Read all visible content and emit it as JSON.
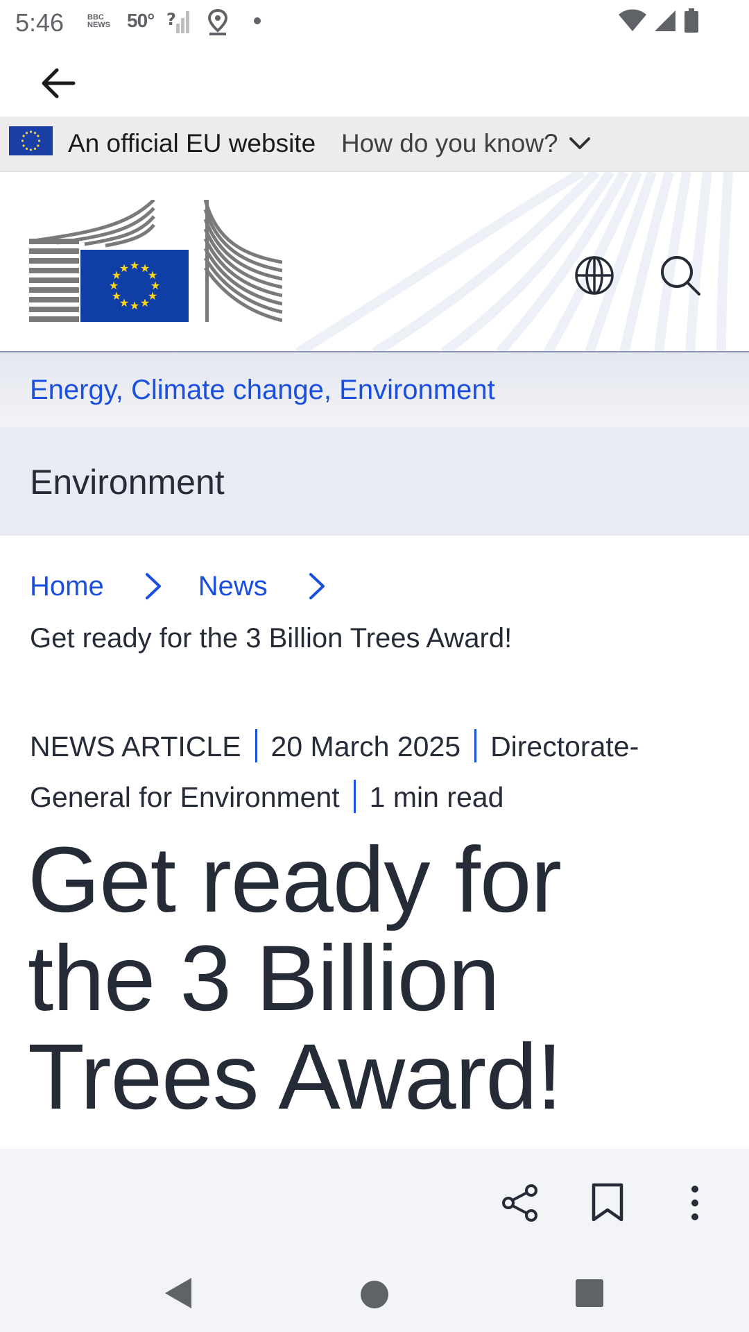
{
  "status_bar": {
    "time": "5:46",
    "news_badge": "BBC NEWS",
    "temperature": "50°"
  },
  "eu_banner": {
    "official_text": "An official EU website",
    "how_text": "How do you know?"
  },
  "site": {
    "link": "Energy, Climate change, Environment",
    "section": "Environment"
  },
  "breadcrumb": {
    "items": [
      "Home",
      "News"
    ],
    "current": "Get ready for the 3 Billion Trees Award!"
  },
  "article": {
    "type": "NEWS ARTICLE",
    "date": "20 March 2025",
    "author": "Directorate-General for Environment",
    "read_time": "1 min read",
    "title": "Get ready for the 3 Billion Trees Award!"
  },
  "colors": {
    "link_blue": "#1a4fe0",
    "eu_blue": "#1a3fa7",
    "eu_yellow": "#ffd617",
    "text_dark": "#262b38"
  },
  "icons": {
    "back": "arrow-left-icon",
    "dropdown": "chevron-down-icon",
    "language": "globe-icon",
    "search": "search-icon",
    "share": "share-icon",
    "bookmark": "bookmark-icon",
    "more": "more-vert-icon"
  }
}
